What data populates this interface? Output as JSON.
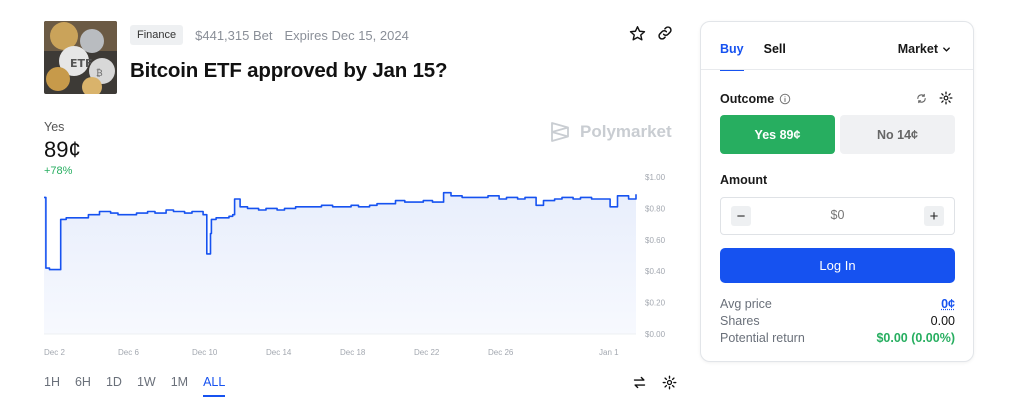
{
  "market": {
    "category": "Finance",
    "volume": "$441,315 Bet",
    "expires": "Expires Dec 15, 2024",
    "title": "Bitcoin ETF approved by Jan 15?",
    "outcome_label": "Yes",
    "price": "89¢",
    "change": "+78%",
    "brand": "Polymarket"
  },
  "range_tabs": [
    "1H",
    "6H",
    "1D",
    "1W",
    "1M",
    "ALL"
  ],
  "range_active": "ALL",
  "trade": {
    "tab_buy": "Buy",
    "tab_sell": "Sell",
    "order_type": "Market",
    "outcome_heading": "Outcome",
    "yes_button": "Yes 89¢",
    "no_button": "No 14¢",
    "amount_heading": "Amount",
    "amount_placeholder": "$0",
    "login_button": "Log In",
    "avg_price_label": "Avg price",
    "avg_price_value": "0¢",
    "shares_label": "Shares",
    "shares_value": "0.00",
    "potential_return_label": "Potential return",
    "potential_return_value": "$0.00 (0.00%)"
  },
  "colors": {
    "accent": "#1652f0",
    "yes_green": "#27ae60",
    "line": "#1652f0"
  },
  "icons": {
    "star": "star-icon",
    "link": "link-icon",
    "info": "info-icon",
    "refresh": "refresh-icon",
    "settings": "gear-icon",
    "swap": "swap-icon"
  },
  "chart_data": {
    "type": "line",
    "series": [
      {
        "x": [
          0,
          0.1,
          0.3,
          0.4,
          0.9,
          1.2,
          1.6,
          2,
          2.4,
          3,
          3.6,
          4,
          4.4,
          5,
          5.6,
          6,
          6.6,
          7,
          7.6,
          8,
          8.6,
          8.8,
          9,
          9.05,
          9.3,
          9.6,
          10,
          10.2,
          10.3,
          10.6,
          11,
          11.6,
          12,
          12.6,
          13,
          13.6,
          14,
          14.6,
          15,
          15.6,
          16,
          16.6,
          17,
          17.6,
          18,
          18.5,
          19,
          19.5,
          20,
          20.5,
          21,
          21.6,
          22,
          22.6,
          23,
          23.6,
          24,
          24.6,
          25,
          25.6,
          26,
          26.4,
          26.6,
          27,
          27.6,
          28,
          28.6,
          29,
          29.6,
          30,
          30.4,
          30.6,
          31,
          31.6,
          32
        ],
        "values": [
          0.87,
          0.42,
          0.41,
          0.41,
          0.73,
          0.74,
          0.74,
          0.74,
          0.76,
          0.78,
          0.77,
          0.76,
          0.76,
          0.77,
          0.78,
          0.77,
          0.79,
          0.78,
          0.77,
          0.78,
          0.76,
          0.51,
          0.64,
          0.73,
          0.74,
          0.74,
          0.75,
          0.76,
          0.86,
          0.81,
          0.8,
          0.79,
          0.8,
          0.79,
          0.8,
          0.81,
          0.81,
          0.81,
          0.82,
          0.81,
          0.81,
          0.82,
          0.81,
          0.82,
          0.83,
          0.83,
          0.85,
          0.84,
          0.84,
          0.85,
          0.84,
          0.9,
          0.88,
          0.87,
          0.87,
          0.87,
          0.88,
          0.86,
          0.87,
          0.86,
          0.87,
          0.87,
          0.82,
          0.85,
          0.86,
          0.87,
          0.86,
          0.87,
          0.86,
          0.86,
          0.86,
          0.81,
          0.88,
          0.86,
          0.89
        ]
      }
    ],
    "x_tick_labels": [
      "Dec 2",
      "Dec 6",
      "Dec 10",
      "Dec 14",
      "Dec 18",
      "Dec 22",
      "Dec 26",
      "Jan 1"
    ],
    "y_tick_labels": [
      "$1.00",
      "$0.80",
      "$0.60",
      "$0.40",
      "$0.20",
      "$0.00"
    ],
    "ylim": [
      0,
      1
    ],
    "grid": false
  }
}
